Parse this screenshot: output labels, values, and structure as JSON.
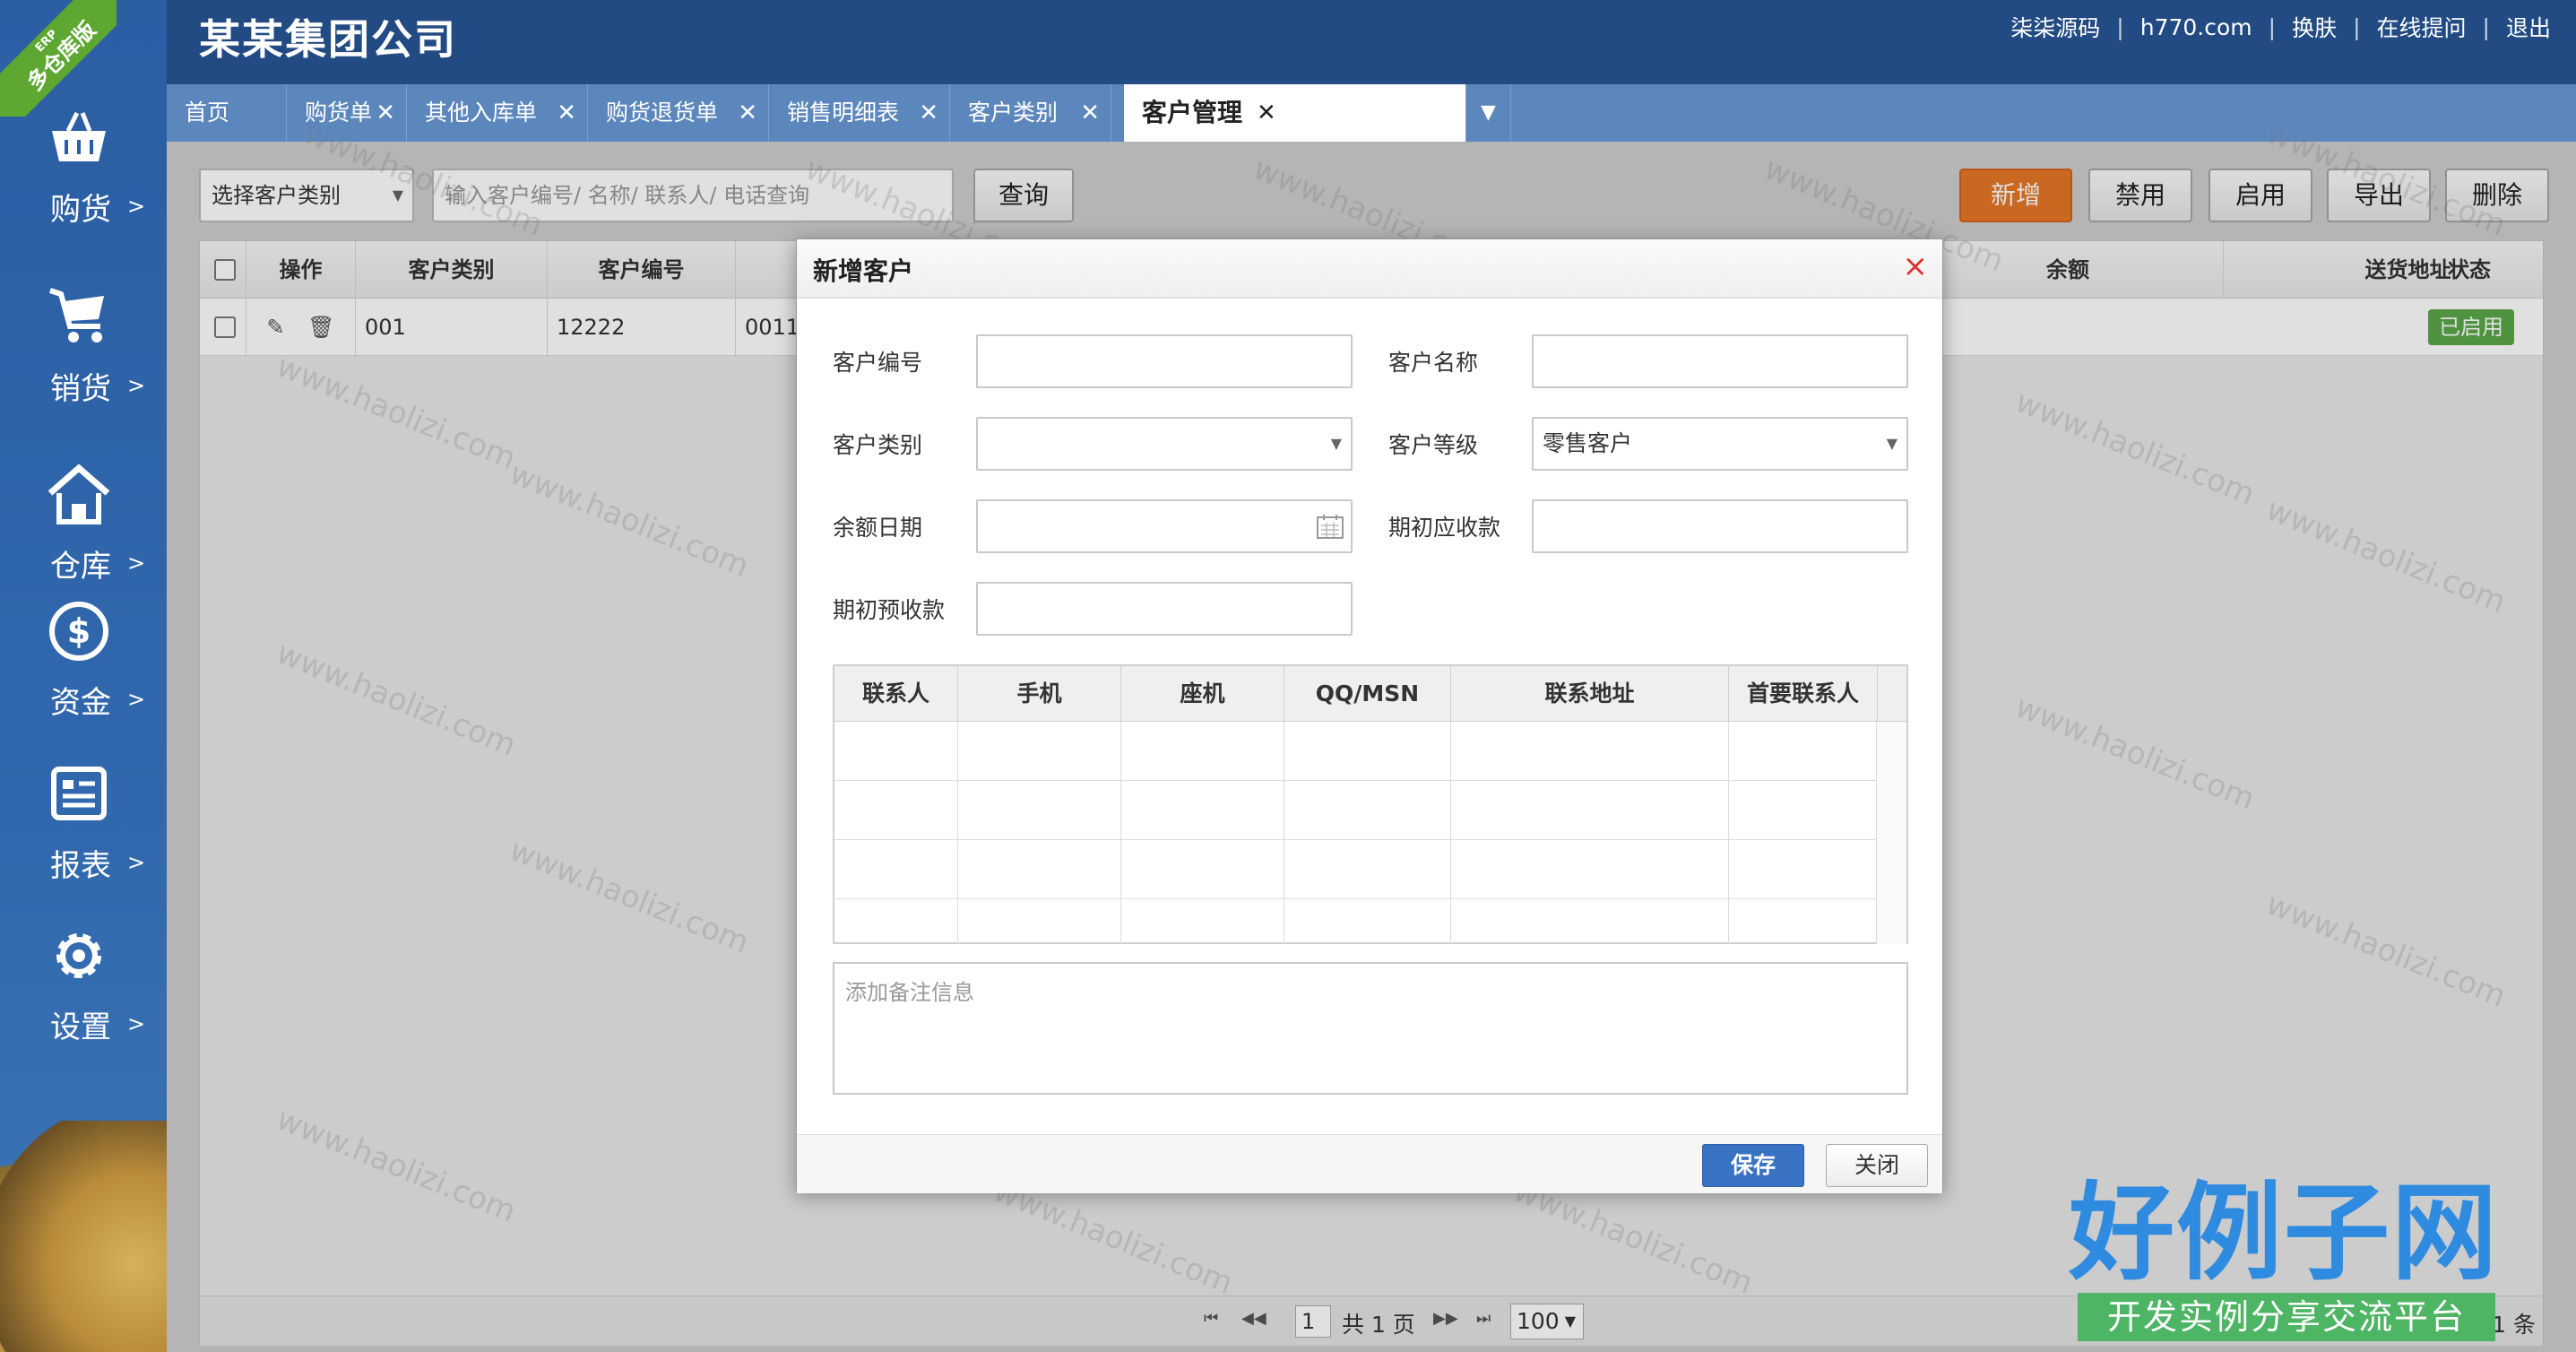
{
  "app": {
    "company": "某某集团公司",
    "ribbon_small": "ERP",
    "ribbon_big": "多仓库版"
  },
  "top_links": [
    "柒柒源码",
    "h770.com",
    "换肤",
    "在线提问",
    "退出"
  ],
  "sidebar": {
    "items": [
      {
        "label": "购货",
        "icon": "basket-icon"
      },
      {
        "label": "销货",
        "icon": "cart-icon"
      },
      {
        "label": "仓库",
        "icon": "house-icon"
      },
      {
        "label": "资金",
        "icon": "dollar-icon"
      },
      {
        "label": "报表",
        "icon": "report-icon"
      },
      {
        "label": "设置",
        "icon": "gear-icon"
      }
    ],
    "arrow": ">"
  },
  "tabs": [
    {
      "label": "首页",
      "closable": false
    },
    {
      "label": "购货单",
      "closable": true
    },
    {
      "label": "其他入库单",
      "closable": true
    },
    {
      "label": "购货退货单",
      "closable": true
    },
    {
      "label": "销售明细表",
      "closable": true
    },
    {
      "label": "客户类别",
      "closable": true
    },
    {
      "label": "客户管理",
      "closable": true,
      "active": true
    }
  ],
  "toolbar": {
    "type_select": "选择客户类别",
    "search_placeholder": "输入客户编号/ 名称/ 联系人/ 电话查询",
    "query": "查询",
    "add": "新增",
    "disable": "禁用",
    "enable": "启用",
    "export": "导出",
    "delete": "删除"
  },
  "grid": {
    "columns": [
      "操作",
      "客户类别",
      "客户编号",
      "余额",
      "送货地址",
      "状态"
    ],
    "row": {
      "type": "001",
      "code": "12222",
      "name_partial": "0011",
      "status": "已启用"
    },
    "pager": {
      "page": "1",
      "total_pages": "共 1 页",
      "page_size": "100",
      "total_records": "共 1 条"
    }
  },
  "modal": {
    "title": "新增客户",
    "close_symbol": "×",
    "fields": {
      "code_label": "客户编号",
      "name_label": "客户名称",
      "type_label": "客户类别",
      "level_label": "客户等级",
      "level_value": "零售客户",
      "balance_date_label": "余额日期",
      "receivable_label": "期初应收款",
      "prepaid_label": "期初预收款"
    },
    "contact_columns": [
      "联系人",
      "手机",
      "座机",
      "QQ/MSN",
      "联系地址",
      "首要联系人"
    ],
    "remark_placeholder": "添加备注信息",
    "save": "保存",
    "close": "关闭"
  },
  "watermark": "www.haolizi.com",
  "brand": {
    "title": "好例子网",
    "subtitle": "开发实例分享交流平台"
  },
  "colors": {
    "header": "#224a83",
    "tabbar": "#5c87bd",
    "add_button": "#e67727",
    "save_button": "#3a72c4",
    "status_badge": "#5aa748"
  }
}
